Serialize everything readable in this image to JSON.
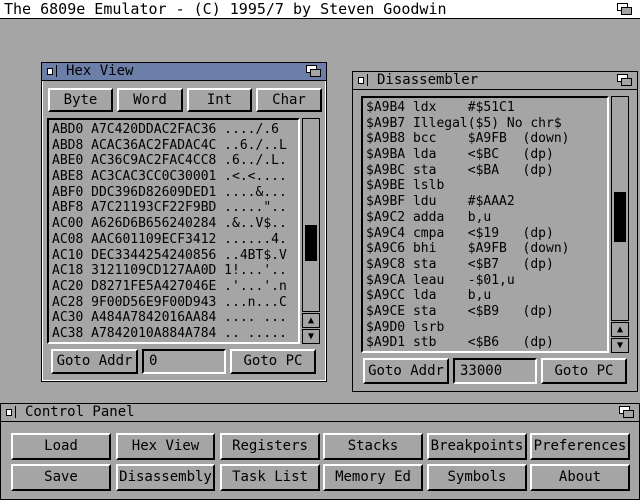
{
  "screen_title": "The 6809e Emulator - (C) 1995/7 by Steven Goodwin",
  "hex_view": {
    "title": "Hex View",
    "mode_buttons": [
      "Byte",
      "Word",
      "Int",
      "Char"
    ],
    "lines": [
      "ABD0 A7C420DDAC2FAC36 ..../.6",
      "ABD8 ACAC36AC2FADAC4C ..6./..L",
      "ABE0 AC36C9AC2FAC4CC8 .6../.L.",
      "ABE8 AC3CAC3CC0C30001 .<.<....",
      "ABF0 DDC396D82609DED1 ....&...",
      "ABF8 A7C21193CF22F9BD .....\"..",
      "AC00 A626D6B656240284 .&..V$..",
      "AC08 AAC601109ECF3412 ......4.",
      "AC10 DEC3344254240856 ..4BT$.V",
      "AC18 3121109CD127AA0D 1!...'..",
      "AC20 D8271FE5A427046E .'...'.n",
      "AC28 9F00D56E9F00D943 ...n...C",
      "AC30 A484A7842016AA84 .... ...",
      "AC38 A7842010A884A784 .. ....."
    ],
    "scroll_position": 0.68,
    "goto_addr_label": "Goto Addr",
    "goto_addr_value": "0",
    "goto_pc_label": "Goto PC"
  },
  "disassembler": {
    "title": "Disassembler",
    "lines": [
      "$A9B4 ldx    #$51C1",
      "$A9B7 Illegal($5) No chr$",
      "$A9B8 bcc    $A9FB  (down)",
      "$A9BA lda    <$BC   (dp)",
      "$A9BC sta    <$BA   (dp)",
      "$A9BE lslb",
      "$A9BF ldu    #$AAA2",
      "$A9C2 adda   b,u",
      "$A9C4 cmpa   <$19   (dp)",
      "$A9C6 bhi    $A9FB  (down)",
      "$A9C8 sta    <$B7   (dp)",
      "$A9CA leau   -$01,u",
      "$A9CC lda    b,u",
      "$A9CE sta    <$B9   (dp)",
      "$A9D0 lsrb",
      "$A9D1 stb    <$B6   (dp)"
    ],
    "scroll_position": 0.55,
    "goto_addr_label": "Goto Addr",
    "goto_addr_value": "33000",
    "goto_pc_label": "Goto PC"
  },
  "control_panel": {
    "title": "Control Panel",
    "row1": [
      "Load",
      "Hex View",
      "Registers",
      "Stacks",
      "Breakpoints",
      "Preferences"
    ],
    "row2": [
      "Save",
      "Disassembly",
      "Task List",
      "Memory Ed",
      "Symbols",
      "About"
    ]
  },
  "icons": [
    "close-gadget-icon",
    "depth-gadget-icon",
    "scroll-up-arrow-icon",
    "scroll-down-arrow-icon"
  ]
}
